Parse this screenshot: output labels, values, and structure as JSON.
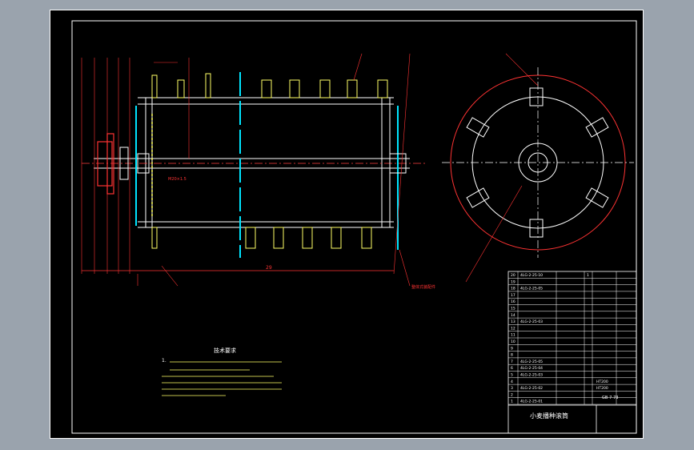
{
  "drawing": {
    "notes_title": "技术要求",
    "notes_number": "1.",
    "title_name": "小麦播种滚筒",
    "drawing_code": "GB-7-73",
    "length_dimension": "29",
    "part_callout": "整体式装配件",
    "callout_label": "M20×1.5",
    "parts_table": {
      "rows": [
        {
          "no": "20",
          "code": "4LG-2-25-10",
          "name": "",
          "qty": "1",
          "note": ""
        },
        {
          "no": "19",
          "code": "",
          "name": "",
          "qty": "",
          "note": ""
        },
        {
          "no": "18",
          "code": "4LG-2-25-05",
          "name": "",
          "qty": "",
          "note": ""
        },
        {
          "no": "17",
          "code": "",
          "name": "",
          "qty": "",
          "note": ""
        },
        {
          "no": "16",
          "code": "",
          "name": "",
          "qty": "",
          "note": ""
        },
        {
          "no": "15",
          "code": "",
          "name": "",
          "qty": "",
          "note": ""
        },
        {
          "no": "14",
          "code": "",
          "name": "",
          "qty": "",
          "note": ""
        },
        {
          "no": "13",
          "code": "4LG-2-25-03",
          "name": "",
          "qty": "",
          "note": ""
        },
        {
          "no": "12",
          "code": "",
          "name": "",
          "qty": "",
          "note": ""
        },
        {
          "no": "11",
          "code": "",
          "name": "",
          "qty": "",
          "note": ""
        },
        {
          "no": "10",
          "code": "",
          "name": "",
          "qty": "",
          "note": ""
        },
        {
          "no": "9",
          "code": "",
          "name": "",
          "qty": "",
          "note": ""
        },
        {
          "no": "8",
          "code": "",
          "name": "",
          "qty": "",
          "note": ""
        },
        {
          "no": "7",
          "code": "4LG-2-25-05",
          "name": "",
          "qty": "",
          "note": ""
        },
        {
          "no": "6",
          "code": "4LG-2-25-04",
          "name": "",
          "qty": "",
          "note": ""
        },
        {
          "no": "5",
          "code": "4LG-2-25-03",
          "name": "",
          "qty": "",
          "note": ""
        },
        {
          "no": "4",
          "code": "",
          "name": "",
          "qty": "",
          "note": "HT200"
        },
        {
          "no": "3",
          "code": "4LG-2-25-02",
          "name": "",
          "qty": "",
          "note": "HT200"
        },
        {
          "no": "2",
          "code": "",
          "name": "",
          "qty": "",
          "note": ""
        },
        {
          "no": "1",
          "code": "4LG-2-25-01",
          "name": "",
          "qty": "",
          "note": ""
        }
      ]
    }
  }
}
